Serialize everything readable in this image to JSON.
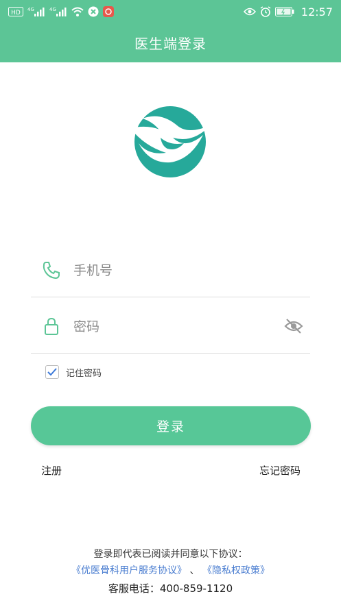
{
  "status_bar": {
    "left_icons": [
      "hd-icon",
      "signal-4g-1-icon",
      "signal-4g-2-icon",
      "wifi-icon",
      "app-icon-1",
      "app-icon-2"
    ],
    "hd_label": "HD",
    "net_label_1": "4G",
    "net_label_2": "4G",
    "time": "12:57"
  },
  "header": {
    "title": "医生端登录"
  },
  "form": {
    "phone_placeholder": "手机号",
    "password_placeholder": "密码",
    "remember_label": "记住密码",
    "remember_checked": true
  },
  "buttons": {
    "login": "登录",
    "register": "注册",
    "forgot": "忘记密码"
  },
  "agreement": {
    "intro": "登录即代表已阅读并同意以下协议：",
    "user_agreement": "《优医骨科用户服务协议》",
    "separator": "、",
    "privacy_policy": "《隐私权政策》"
  },
  "service": {
    "text": "客服电话：400-859-1120"
  },
  "colors": {
    "brand": "#5cc596",
    "button": "#57c797",
    "link": "#4a7dd0",
    "logo": "#26a99a"
  }
}
